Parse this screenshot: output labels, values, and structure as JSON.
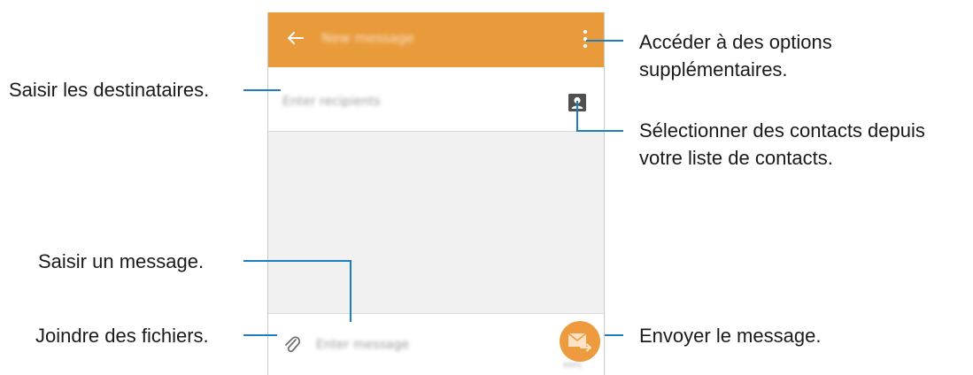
{
  "phone": {
    "toolbar": {
      "title": "New message",
      "bg_color": "#e99a3a",
      "back_icon": "arrow-left-icon",
      "more_icon": "more-vertical-icon"
    },
    "recipients": {
      "placeholder": "Enter recipients",
      "contact_icon": "contact-card-icon"
    },
    "composer": {
      "placeholder": "Enter message",
      "attach_icon": "paperclip-icon",
      "send_icon": "send-message-icon",
      "send_color": "#ee9a3f",
      "send_type": "MMS"
    }
  },
  "annotations": {
    "more_options_1": "Accéder à des options",
    "more_options_2": "supplémentaires.",
    "recipients": "Saisir les destinataires.",
    "contacts_1": "Sélectionner des contacts depuis",
    "contacts_2": "votre liste de contacts.",
    "message": "Saisir un message.",
    "attach": "Joindre des fichiers.",
    "send": "Envoyer le message."
  },
  "line_color": "#1d7fc2"
}
